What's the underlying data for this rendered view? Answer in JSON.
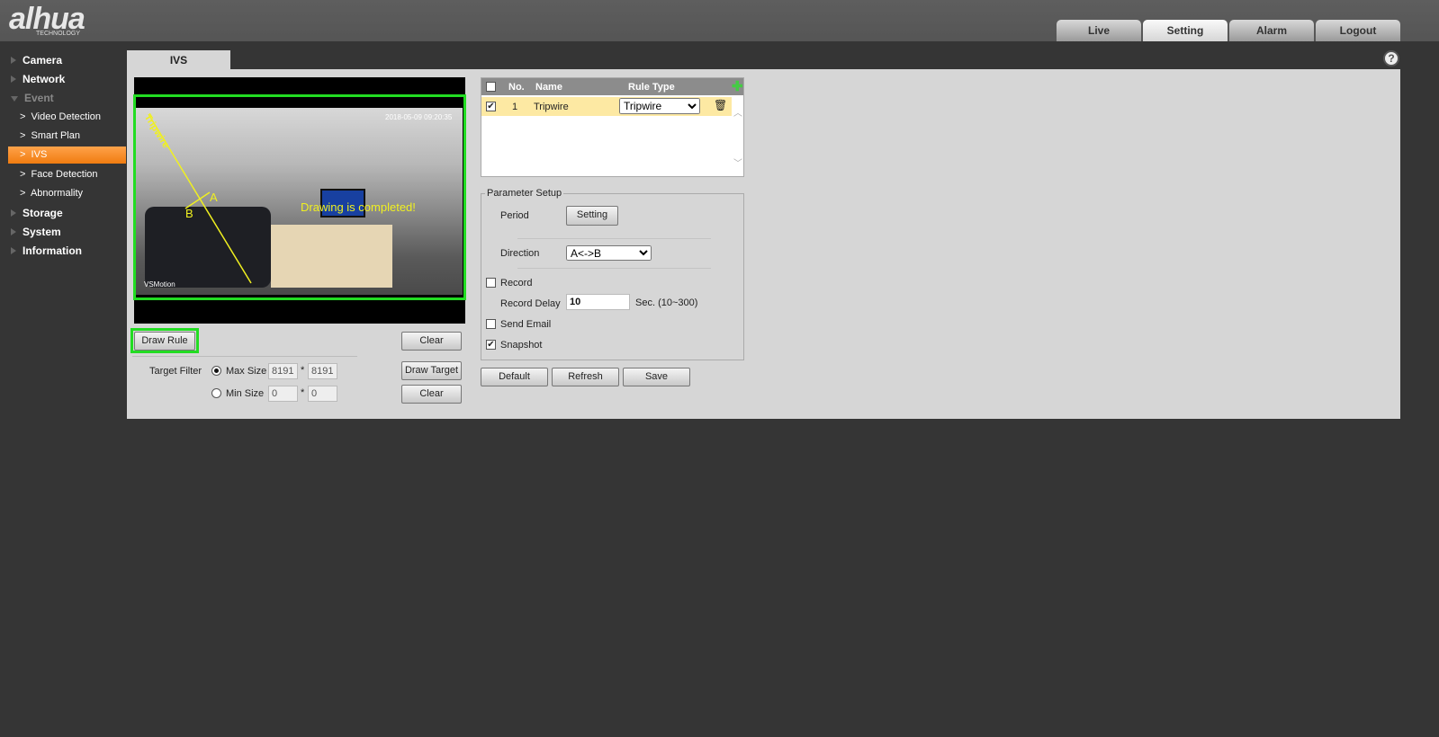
{
  "header": {
    "logo": "alhua",
    "logo_sub": "TECHNOLOGY",
    "tabs": [
      {
        "label": "Live"
      },
      {
        "label": "Setting",
        "active": true
      },
      {
        "label": "Alarm"
      },
      {
        "label": "Logout"
      }
    ]
  },
  "sidebar": {
    "items": [
      {
        "label": "Camera"
      },
      {
        "label": "Network"
      },
      {
        "label": "Event",
        "open": true
      },
      {
        "label": "Storage"
      },
      {
        "label": "System"
      },
      {
        "label": "Information"
      }
    ],
    "event_sub": [
      {
        "label": "Video Detection"
      },
      {
        "label": "Smart Plan"
      },
      {
        "label": "IVS",
        "active": true
      },
      {
        "label": "Face Detection"
      },
      {
        "label": "Abnormality"
      }
    ]
  },
  "page": {
    "tab": "IVS",
    "help_icon": "?"
  },
  "video": {
    "rule_label": "Tripwire",
    "dir_a": "A",
    "dir_b": "B",
    "status": "Drawing is completed!",
    "timestamp": "2018-05-09 09:20:35",
    "channel": "VSMotion",
    "rule_color": "#f0f020",
    "frame_color": "#22dd22"
  },
  "controls": {
    "draw_rule": "Draw Rule",
    "clear": "Clear",
    "target_filter": "Target Filter",
    "max_size": "Max Size",
    "min_size": "Min Size",
    "max_w": "8191",
    "max_h": "8191",
    "min_w": "0",
    "min_h": "0",
    "times": "*",
    "draw_target": "Draw Target",
    "clear2": "Clear"
  },
  "rules": {
    "headers": {
      "no": "No.",
      "name": "Name",
      "type": "Rule Type"
    },
    "rows": [
      {
        "checked": true,
        "no": "1",
        "name": "Tripwire",
        "type": "Tripwire"
      }
    ]
  },
  "params": {
    "legend": "Parameter Setup",
    "period": "Period",
    "setting": "Setting",
    "direction": "Direction",
    "direction_value": "A<->B",
    "record": "Record",
    "record_delay": "Record Delay",
    "record_delay_value": "10",
    "delay_unit": "Sec. (10~300)",
    "send_email": "Send Email",
    "snapshot": "Snapshot"
  },
  "footer": {
    "default": "Default",
    "refresh": "Refresh",
    "save": "Save"
  }
}
